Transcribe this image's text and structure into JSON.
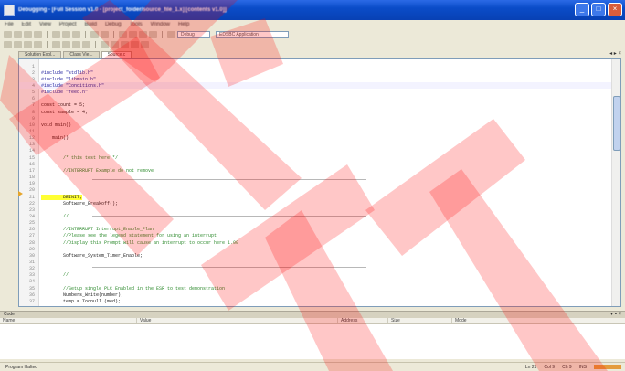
{
  "window": {
    "title": "Debugging - [Full Session v1.0 - [project_folder/source_file_1.x] [contents v1.0]]"
  },
  "menu": [
    "File",
    "Edit",
    "View",
    "Project",
    "Build",
    "Debug",
    "Tools",
    "Window",
    "Help"
  ],
  "toolbar": {
    "config_combo": "Debug",
    "target_combo": "EDSBC Application"
  },
  "tabs": [
    "Solution Expl...",
    "Class Vie...",
    "Source.c"
  ],
  "tab_controls": "◂ ▸ ×",
  "code_lines": [
    {
      "ln": "1",
      "text": "",
      "style": "plain"
    },
    {
      "ln": "2",
      "text": "#include \"stdlib.h\"",
      "style": "pre"
    },
    {
      "ln": "3",
      "text": "#include \"libmain.h\"",
      "style": "pre"
    },
    {
      "ln": "4",
      "text": "#include \"Conditions.h\"",
      "style": "pre"
    },
    {
      "ln": "5",
      "text": "#include \"feed.h\"",
      "style": "pre"
    },
    {
      "ln": "6",
      "text": "",
      "style": "plain"
    },
    {
      "ln": "7",
      "text": "const count = 5;",
      "style": "plain"
    },
    {
      "ln": "8",
      "text": "const sample = 4;",
      "style": "plain"
    },
    {
      "ln": "9",
      "text": "",
      "style": "plain"
    },
    {
      "ln": "10",
      "text": "void main()",
      "style": "plain"
    },
    {
      "ln": "11",
      "text": "",
      "style": "plain"
    },
    {
      "ln": "12",
      "text": "    main()",
      "style": "plain"
    },
    {
      "ln": "13",
      "text": "",
      "style": "plain"
    },
    {
      "ln": "14",
      "text": "",
      "style": "plain"
    },
    {
      "ln": "15",
      "text": "        /* this test here */",
      "style": "cm"
    },
    {
      "ln": "16",
      "text": "",
      "style": "plain"
    },
    {
      "ln": "17",
      "text": "        //INTERRUPT Example do not remove",
      "style": "cm"
    },
    {
      "ln": "18",
      "text": "",
      "style": "plain"
    },
    {
      "ln": "19",
      "text": "",
      "style": "plain"
    },
    {
      "ln": "20",
      "text": "",
      "style": "plain"
    },
    {
      "ln": "21",
      "text": "        DEINIT;",
      "style": "hl"
    },
    {
      "ln": "22",
      "text": "        Software_Breakoff();",
      "style": "plain"
    },
    {
      "ln": "23",
      "text": "",
      "style": "plain"
    },
    {
      "ln": "24",
      "text": "        //",
      "style": "cm"
    },
    {
      "ln": "25",
      "text": "",
      "style": "plain"
    },
    {
      "ln": "26",
      "text": "        //INTERRUPT Interrupt_Enable_Plan",
      "style": "cm"
    },
    {
      "ln": "27",
      "text": "        //Please see the legend statement for using an interrupt",
      "style": "cm"
    },
    {
      "ln": "28",
      "text": "        //Display this Prompt will cause an interrupt to occur here 1.00",
      "style": "cm"
    },
    {
      "ln": "29",
      "text": "",
      "style": "plain"
    },
    {
      "ln": "30",
      "text": "        Software_System_Timer_Enable;",
      "style": "plain"
    },
    {
      "ln": "31",
      "text": "",
      "style": "plain"
    },
    {
      "ln": "32",
      "text": "",
      "style": "plain"
    },
    {
      "ln": "33",
      "text": "        //",
      "style": "cm"
    },
    {
      "ln": "34",
      "text": "",
      "style": "plain"
    },
    {
      "ln": "35",
      "text": "        //Setup single PLC Enabled in the ESR to test demonstration",
      "style": "cm"
    },
    {
      "ln": "36",
      "text": "        Numbers_Write(number);",
      "style": "plain"
    },
    {
      "ln": "37",
      "text": "        temp = Tocnull (med);",
      "style": "plain"
    }
  ],
  "output": {
    "panel_title": "Code",
    "panel_controls": "▾ ▪ ×",
    "columns": [
      "Name",
      "Value",
      "Address",
      "Size",
      "Mode"
    ]
  },
  "status": {
    "left": "Program Halted",
    "right": [
      "Ln 21",
      "Col 9",
      "Ch 9",
      "INS"
    ]
  },
  "accent_color": "#0a4cc8",
  "highlight_color": "#ffff33",
  "watermark_color": "#ff0000"
}
